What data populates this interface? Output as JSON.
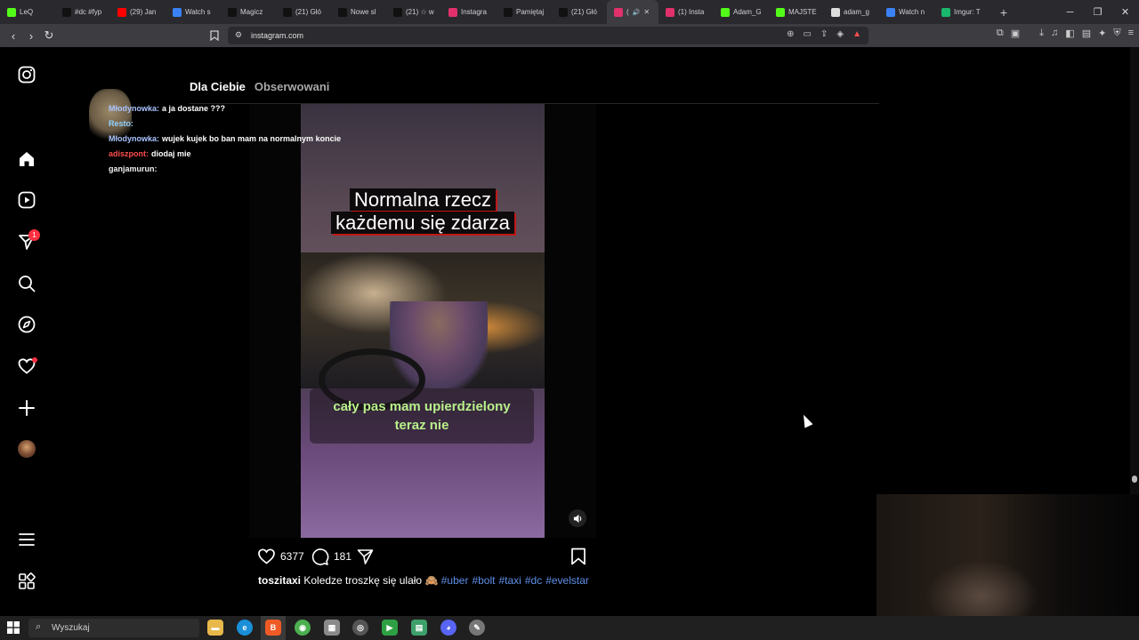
{
  "browser": {
    "tabs": [
      {
        "label": "LeQ",
        "icon": "kick-icon",
        "color": "#53fc18"
      },
      {
        "label": "#dc #fyp",
        "icon": "tiktok-icon",
        "color": "#111111"
      },
      {
        "label": "(29) Jan",
        "icon": "youtube-icon",
        "color": "#ff0000"
      },
      {
        "label": "Watch s",
        "icon": "watch-icon",
        "color": "#3b82f6"
      },
      {
        "label": "Magicz",
        "icon": "tiktok-icon",
        "color": "#111111"
      },
      {
        "label": "(21) Głó",
        "icon": "x-icon",
        "color": "#111111"
      },
      {
        "label": "Nowe sl",
        "icon": "tiktok-icon",
        "color": "#111111"
      },
      {
        "label": "(21) ☆ w",
        "icon": "x-icon",
        "color": "#111111"
      },
      {
        "label": "Instagra",
        "icon": "instagram-icon",
        "color": "#e1306c"
      },
      {
        "label": "Pamiętaj",
        "icon": "tiktok-icon",
        "color": "#111111"
      },
      {
        "label": "(21) Głó",
        "icon": "x-icon",
        "color": "#111111"
      },
      {
        "label": "(",
        "icon": "instagram-icon",
        "color": "#e1306c",
        "active": true
      },
      {
        "label": "(1) Insta",
        "icon": "instagram-icon",
        "color": "#e1306c"
      },
      {
        "label": "Adam_G",
        "icon": "kick-icon",
        "color": "#53fc18"
      },
      {
        "label": "MAJSTE",
        "icon": "kick-icon",
        "color": "#53fc18"
      },
      {
        "label": "adam_g",
        "icon": "diamond-icon",
        "color": "#dddddd"
      },
      {
        "label": "Watch n",
        "icon": "watch-icon",
        "color": "#3b82f6"
      },
      {
        "label": "Imgur: T",
        "icon": "imgur-icon",
        "color": "#1bb76e"
      }
    ],
    "new_tab": "+",
    "url": "instagram.com"
  },
  "feed": {
    "tab_for_you": "Dla Ciebie",
    "tab_following": "Obserwowani"
  },
  "chat": [
    {
      "user": "Młodynowka:",
      "message": "a ja dostane ???",
      "user_color": "#a9c4ff"
    },
    {
      "user": "Resto:",
      "message": "",
      "user_color": "#8fd3ff"
    },
    {
      "user": "Młodynowka:",
      "message": "wujek kujek bo ban mam na normalnym koncie",
      "user_color": "#a9c4ff"
    },
    {
      "user": "adiszpont:",
      "message": "diodaj mie",
      "user_color": "#ff4d4d"
    },
    {
      "user": "ganjamurun:",
      "message": "",
      "user_color": "#f0f0f0"
    }
  ],
  "reel": {
    "title_line1": "Normalna rzecz",
    "title_line2": "każdemu się zdarza",
    "subtitle_line1": "cały pas mam upierdzielony",
    "subtitle_line2": "teraz nie",
    "likes": "6377",
    "comments": "181",
    "caption_user": "toszitaxi",
    "caption_text": "Koledze troszkę się ulało",
    "hashtags": [
      "#uber",
      "#bolt",
      "#taxi",
      "#dc",
      "#evelstar"
    ]
  },
  "notifications": {
    "reels_badge": "1"
  },
  "taskbar": {
    "search_placeholder": "Wyszukaj"
  },
  "colors": {
    "accent_blue": "#5d8fe8",
    "notification_red": "#ff3040",
    "subtitle_green": "#b8f08a"
  }
}
